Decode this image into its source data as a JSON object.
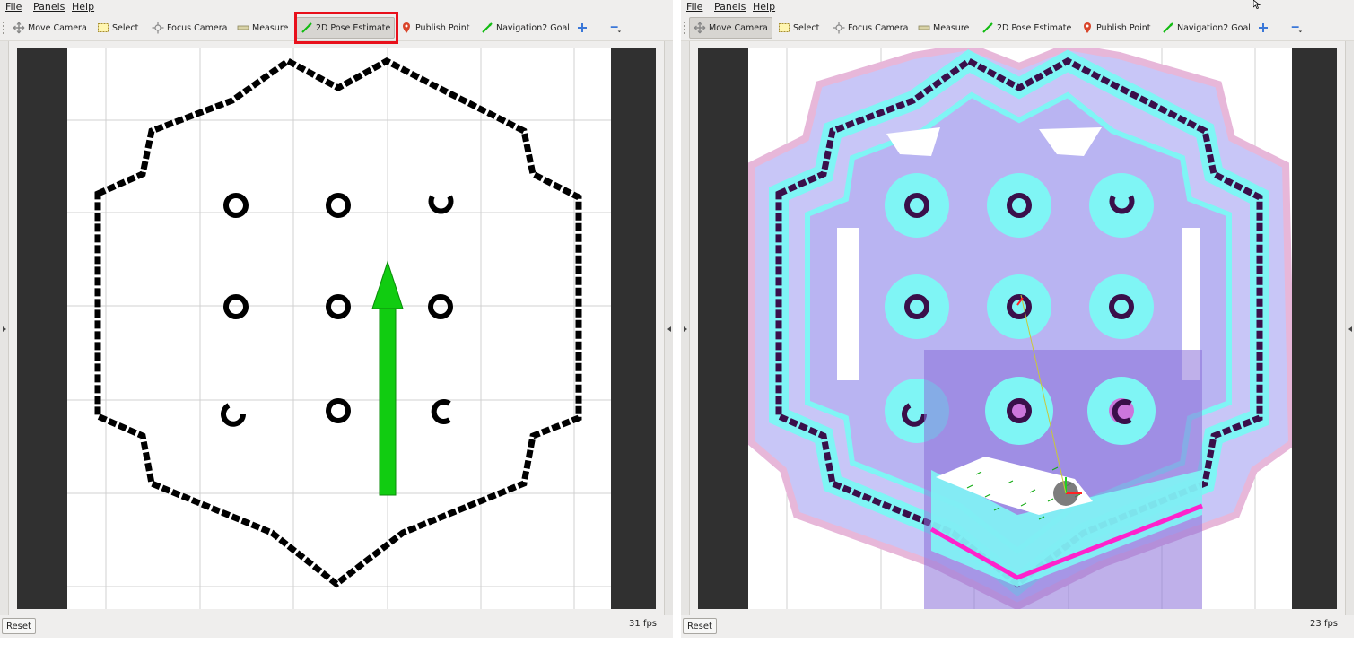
{
  "menu": {
    "file": "File",
    "panels": "Panels",
    "help": "Help"
  },
  "tools": {
    "move_camera": "Move Camera",
    "select": "Select",
    "focus_camera": "Focus Camera",
    "measure": "Measure",
    "pose_estimate": "2D Pose Estimate",
    "publish_point": "Publish Point",
    "nav_goal": "Navigation2 Goal"
  },
  "colors": {
    "highlight": "#e8101b",
    "arrow": "#11cc11",
    "map_wall": "#000000",
    "costmap_inflation": "#b3b0f3",
    "costmap_inscribed": "#7ff5f5",
    "lethal": "#ff22cc"
  },
  "icons": [
    "move-camera-icon",
    "select-icon",
    "focus-camera-icon",
    "measure-icon",
    "pose-estimate-icon",
    "publish-point-icon",
    "nav-goal-icon",
    "plus-icon",
    "minus-icon"
  ],
  "left_panel": {
    "active_tool": "2D Pose Estimate",
    "reset_label": "Reset",
    "fps": "31 fps"
  },
  "right_panel": {
    "active_tool": "Move Camera",
    "reset_label": "Reset",
    "fps": "23 fps"
  }
}
